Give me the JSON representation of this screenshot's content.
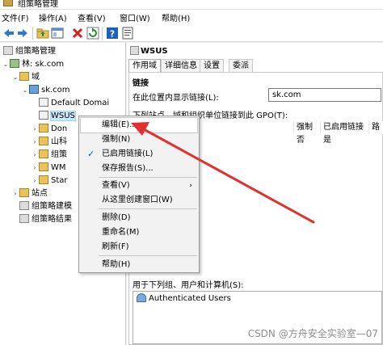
{
  "window": {
    "title": "组策略管理"
  },
  "menu": [
    "文件(F)",
    "操作(A)",
    "查看(V)",
    "窗口(W)",
    "帮助(H)"
  ],
  "toolbar": [
    "back-icon",
    "forward-icon",
    "folder-up-icon",
    "console-tree-icon",
    "delete-icon",
    "refresh-icon",
    "help-icon",
    "properties-icon"
  ],
  "tree": {
    "root": "组策略管理",
    "forest": "林: sk.com",
    "domains": "域",
    "domain": "sk.com",
    "children": [
      "Default Domai",
      "WSUS",
      "Don",
      "山科",
      "组策",
      "WM",
      "Star"
    ],
    "sites": "站点",
    "modeling": "组策略建模",
    "results": "组策略结果"
  },
  "right": {
    "title": "WSUS",
    "tabs": [
      "作用域",
      "详细信息",
      "设置",
      "委派"
    ],
    "section_links": "链接",
    "show_links_label": "在此位置内显示链接(L):",
    "location_value": "sk.com",
    "links_desc": "下列站点、域和组织单位链接到此 GPO(T):",
    "columns": [
      "",
      "强制",
      "已启用链接",
      "路"
    ],
    "rows": [
      {
        "location": "",
        "enforced": "否",
        "enabled": "是"
      }
    ],
    "security_filter_label": "用于下列组、用户和计算机(S):",
    "groups": [
      "Authenticated Users"
    ]
  },
  "context_menu": {
    "items": [
      {
        "label": "编辑(E)...",
        "highlighted": true
      },
      {
        "label": "强制(N)"
      },
      {
        "label": "已启用链接(L)",
        "checked": true
      },
      {
        "label": "保存报告(S)..."
      },
      {
        "label": "查看(V)",
        "submenu": true
      },
      {
        "label": "从这里创建窗口(W)"
      },
      {
        "label": "删除(D)"
      },
      {
        "label": "重命名(M)"
      },
      {
        "label": "刷新(F)"
      },
      {
        "label": "帮助(H)"
      }
    ]
  },
  "colors": {
    "arrow": "#e03030",
    "selection": "#cce8ff",
    "check": "#0b5fbd"
  },
  "watermark": "CSDN @方舟安全实验室—07"
}
